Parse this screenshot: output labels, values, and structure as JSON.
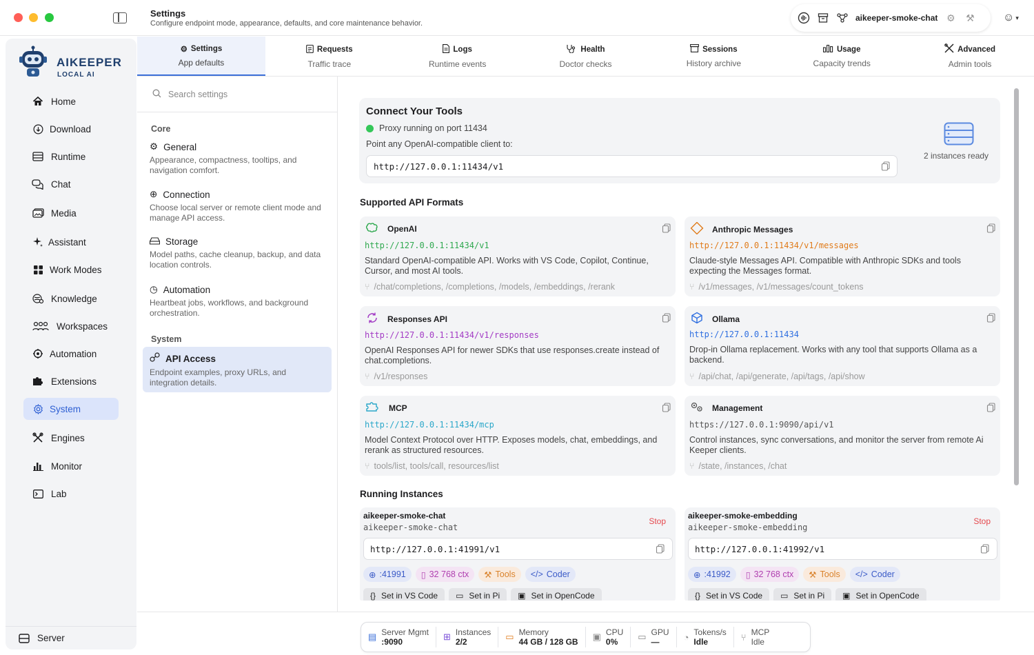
{
  "header": {
    "title": "Settings",
    "subtitle": "Configure endpoint mode, appearance, defaults, and core maintenance behavior.",
    "instance_name": "aikeeper-smoke-chat"
  },
  "brand": {
    "name": "AIKEEPER",
    "tagline": "LOCAL AI"
  },
  "sidebar": {
    "items": [
      {
        "label": "Home",
        "icon": "home-icon"
      },
      {
        "label": "Download",
        "icon": "download-icon"
      },
      {
        "label": "Runtime",
        "icon": "runtime-icon"
      },
      {
        "label": "Chat",
        "icon": "chat-icon"
      },
      {
        "label": "Media",
        "icon": "media-icon"
      },
      {
        "label": "Assistant",
        "icon": "sparkle-icon"
      },
      {
        "label": "Work Modes",
        "icon": "grid-icon"
      },
      {
        "label": "Knowledge",
        "icon": "knowledge-icon"
      },
      {
        "label": "Workspaces",
        "icon": "people-icon"
      },
      {
        "label": "Automation",
        "icon": "automation-icon"
      },
      {
        "label": "Extensions",
        "icon": "puzzle-icon"
      },
      {
        "label": "System",
        "icon": "gear-icon",
        "active": true
      },
      {
        "label": "Engines",
        "icon": "tools-icon"
      },
      {
        "label": "Monitor",
        "icon": "chart-icon"
      },
      {
        "label": "Lab",
        "icon": "terminal-icon"
      }
    ],
    "server_label": "Server"
  },
  "tabs": [
    {
      "title": "Settings",
      "sub": "App defaults",
      "icon": "gear-icon",
      "active": true
    },
    {
      "title": "Requests",
      "sub": "Traffic trace",
      "icon": "clipboard-icon"
    },
    {
      "title": "Logs",
      "sub": "Runtime events",
      "icon": "doc-icon"
    },
    {
      "title": "Health",
      "sub": "Doctor checks",
      "icon": "stethoscope-icon"
    },
    {
      "title": "Sessions",
      "sub": "History archive",
      "icon": "archive-icon"
    },
    {
      "title": "Usage",
      "sub": "Capacity trends",
      "icon": "bars-icon"
    },
    {
      "title": "Advanced",
      "sub": "Admin tools",
      "icon": "wrench-icon"
    }
  ],
  "settings_nav": {
    "search_placeholder": "Search settings",
    "group_core": "Core",
    "group_system": "System",
    "core": [
      {
        "title": "General",
        "desc": "Appearance, compactness, tooltips, and navigation comfort."
      },
      {
        "title": "Connection",
        "desc": "Choose local server or remote client mode and manage API access."
      },
      {
        "title": "Storage",
        "desc": "Model paths, cache cleanup, backup, and data location controls."
      },
      {
        "title": "Automation",
        "desc": "Heartbeat jobs, workflows, and background orchestration."
      }
    ],
    "system": [
      {
        "title": "API Access",
        "desc": "Endpoint examples, proxy URLs, and integration details."
      }
    ]
  },
  "connect": {
    "title": "Connect Your Tools",
    "status": "Proxy running on port 11434",
    "point": "Point any OpenAI-compatible client to:",
    "url": "http://127.0.0.1:11434/v1",
    "ready": "2 instances ready"
  },
  "formats_title": "Supported API Formats",
  "formats": [
    {
      "name": "OpenAI",
      "url": "http://127.0.0.1:11434/v1",
      "color": "#2fa84f",
      "desc": "Standard OpenAI-compatible API. Works with VS Code, Copilot, Continue, Cursor, and most AI tools.",
      "endpoints": "/chat/completions, /completions, /models, /embeddings, /rerank"
    },
    {
      "name": "Anthropic Messages",
      "url": "http://127.0.0.1:11434/v1/messages",
      "color": "#e07b1a",
      "desc": "Claude-style Messages API. Compatible with Anthropic SDKs and tools expecting the Messages format.",
      "endpoints": "/v1/messages, /v1/messages/count_tokens"
    },
    {
      "name": "Responses API",
      "url": "http://127.0.0.1:11434/v1/responses",
      "color": "#a23ac4",
      "desc": "OpenAI Responses API for newer SDKs that use responses.create instead of chat.completions.",
      "endpoints": "/v1/responses"
    },
    {
      "name": "Ollama",
      "url": "http://127.0.0.1:11434",
      "color": "#2f6fe0",
      "desc": "Drop-in Ollama replacement. Works with any tool that supports Ollama as a backend.",
      "endpoints": "/api/chat, /api/generate, /api/tags, /api/show"
    },
    {
      "name": "MCP",
      "url": "http://127.0.0.1:11434/mcp",
      "color": "#2aa7c9",
      "desc": "Model Context Protocol over HTTP. Exposes models, chat, embeddings, and rerank as structured resources.",
      "endpoints": "tools/list, tools/call, resources/list"
    },
    {
      "name": "Management",
      "url": "https://127.0.0.1:9090/api/v1",
      "color": "#555555",
      "desc": "Control instances, sync conversations, and monitor the server from remote Ai Keeper clients.",
      "endpoints": "/state, /instances, /chat"
    }
  ],
  "instances_title": "Running Instances",
  "instances": [
    {
      "name": "aikeeper-smoke-chat",
      "model": "aikeeper-smoke-chat",
      "url": "http://127.0.0.1:41991/v1",
      "port": ":41991",
      "ctx": "32 768 ctx",
      "tools": "Tools",
      "coder": "Coder",
      "stop": "Stop",
      "act1": "Set in VS Code",
      "act2": "Set in Pi",
      "act3": "Set in OpenCode"
    },
    {
      "name": "aikeeper-smoke-embedding",
      "model": "aikeeper-smoke-embedding",
      "url": "http://127.0.0.1:41992/v1",
      "port": ":41992",
      "ctx": "32 768 ctx",
      "tools": "Tools",
      "coder": "Coder",
      "stop": "Stop",
      "act1": "Set in VS Code",
      "act2": "Set in Pi",
      "act3": "Set in OpenCode"
    }
  ],
  "status": [
    {
      "label": "Server Mgmt",
      "value": ":9090",
      "icon": "server-icon"
    },
    {
      "label": "Instances",
      "value": "2/2",
      "icon": "grid-icon"
    },
    {
      "label": "Memory",
      "value": "44 GB / 128 GB",
      "icon": "memory-icon"
    },
    {
      "label": "CPU",
      "value": "0%",
      "icon": "cpu-icon"
    },
    {
      "label": "GPU",
      "value": "—",
      "icon": "monitor-icon"
    },
    {
      "label": "Tokens/s",
      "value": "Idle",
      "icon": "speed-icon"
    },
    {
      "label": "MCP",
      "value": "Idle",
      "icon": "mcp-icon"
    }
  ]
}
